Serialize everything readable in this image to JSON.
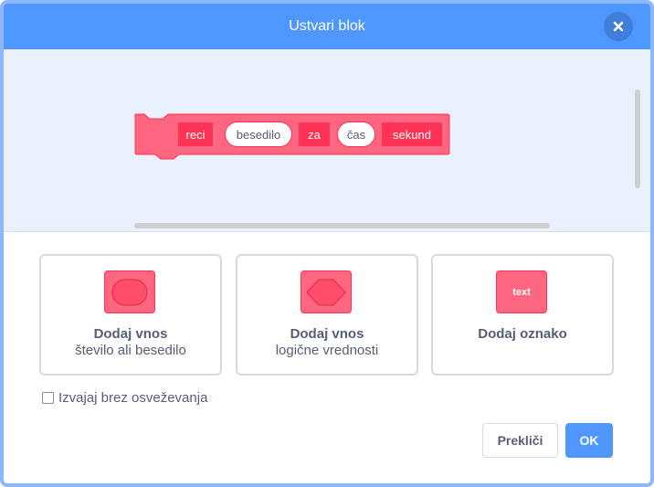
{
  "dialog": {
    "title": "Ustvari blok",
    "close_icon": "close-icon"
  },
  "block": {
    "parts": [
      {
        "kind": "label",
        "text": "reci"
      },
      {
        "kind": "input",
        "text": "besedilo"
      },
      {
        "kind": "label",
        "text": "za"
      },
      {
        "kind": "input",
        "text": "čas"
      },
      {
        "kind": "label",
        "text": "sekund"
      }
    ],
    "color": "#ff6680",
    "border_color": "#ff3355"
  },
  "cards": [
    {
      "title": "Dodaj vnos",
      "subtitle": "število ali besedilo",
      "icon": "oval-input-icon"
    },
    {
      "title": "Dodaj vnos",
      "subtitle": "logične vrednosti",
      "icon": "hexagon-input-icon"
    },
    {
      "title": "Dodaj oznako",
      "subtitle": "",
      "icon": "text-label-icon",
      "icon_text": "text"
    }
  ],
  "options": {
    "run_without_refresh_label": "Izvajaj brez osveževanja",
    "run_without_refresh_checked": false
  },
  "buttons": {
    "cancel": "Prekliči",
    "ok": "OK"
  },
  "colors": {
    "header": "#4d97ff",
    "workspace": "#e9f1fc",
    "text": "#575e75",
    "accent": "#4d97ff"
  }
}
